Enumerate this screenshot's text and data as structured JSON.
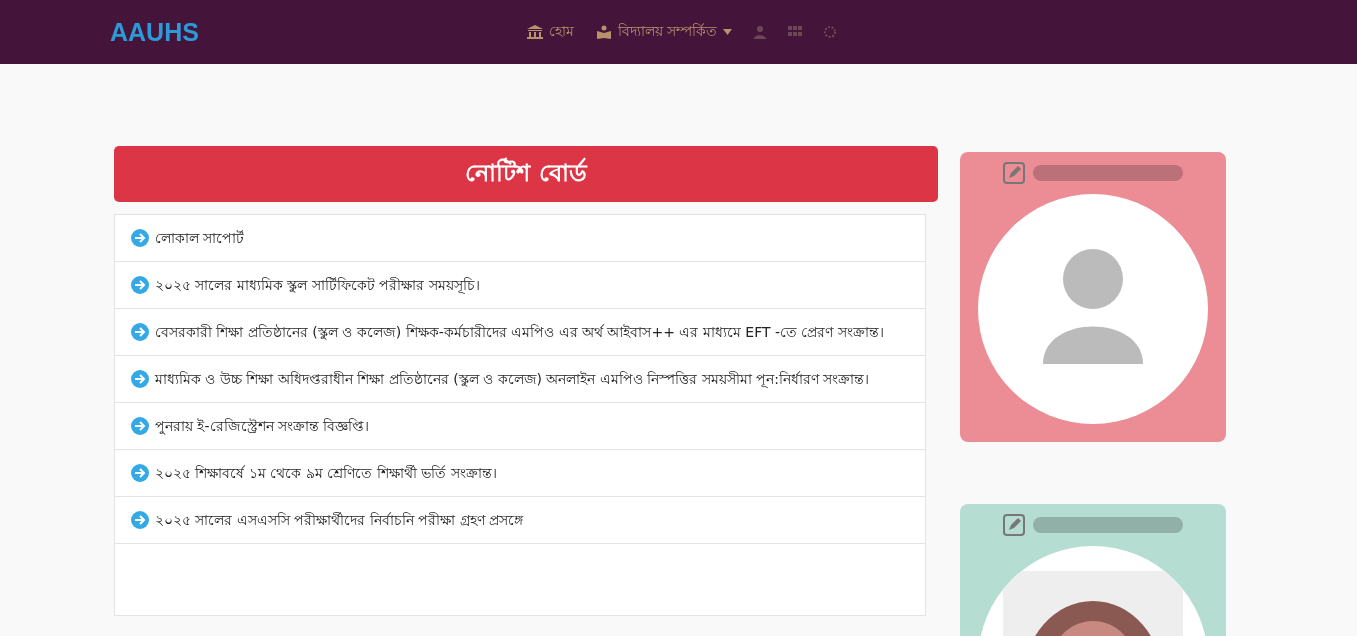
{
  "navbar": {
    "brand": "AAUHS",
    "items": [
      {
        "label": "হোম",
        "kind": "link"
      },
      {
        "label": "বিদ্যালয় সম্পর্কিত",
        "kind": "dropdown"
      }
    ]
  },
  "notice_board": {
    "title": "নোটিশ বোর্ড",
    "notices": [
      {
        "text": "লোকাল সাপোর্ট"
      },
      {
        "text": "২০২৫ সালের মাধ্যমিক স্কুল সার্টিফিকেট পরীক্ষার সময়সূচি।"
      },
      {
        "text": "বেসরকারী শিক্ষা প্রতিষ্ঠানের (স্কুল ও কলেজ) শিক্ষক-কর্মচারীদের এমপিও এর অর্থ আইবাস++ এর মাধ্যমে EFT -তে প্রেরণ সংক্রান্ত।"
      },
      {
        "text": "মাধ্যমিক ও উচ্চ শিক্ষা অধিদপ্তরাধীন শিক্ষা প্রতিষ্ঠানের (স্কুল ও কলেজ) অনলাইন এমপিও নিস্পত্তির সময়সীমা পূন:নির্ধারণ সংক্রান্ত।"
      },
      {
        "text": "পুনরায় ই-রেজিস্ট্রেশন সংক্রান্ত বিজ্ঞপ্তি।"
      },
      {
        "text": "২০২৫ শিক্ষাবর্ষে ১ম থেকে ৯ম শ্রেণিতে শিক্ষার্থী ভর্তি সংক্রান্ত।"
      },
      {
        "text": "২০২৫ সালের এসএসসি পরীক্ষার্থীদের নির্বাচনি পরীক্ষা গ্রহণ প্রসঙ্গে"
      }
    ]
  },
  "profile_cards": [
    {
      "kind": "placeholder",
      "color": "#ec8c95"
    },
    {
      "kind": "picture",
      "color": "#b5ddd2"
    }
  ]
}
